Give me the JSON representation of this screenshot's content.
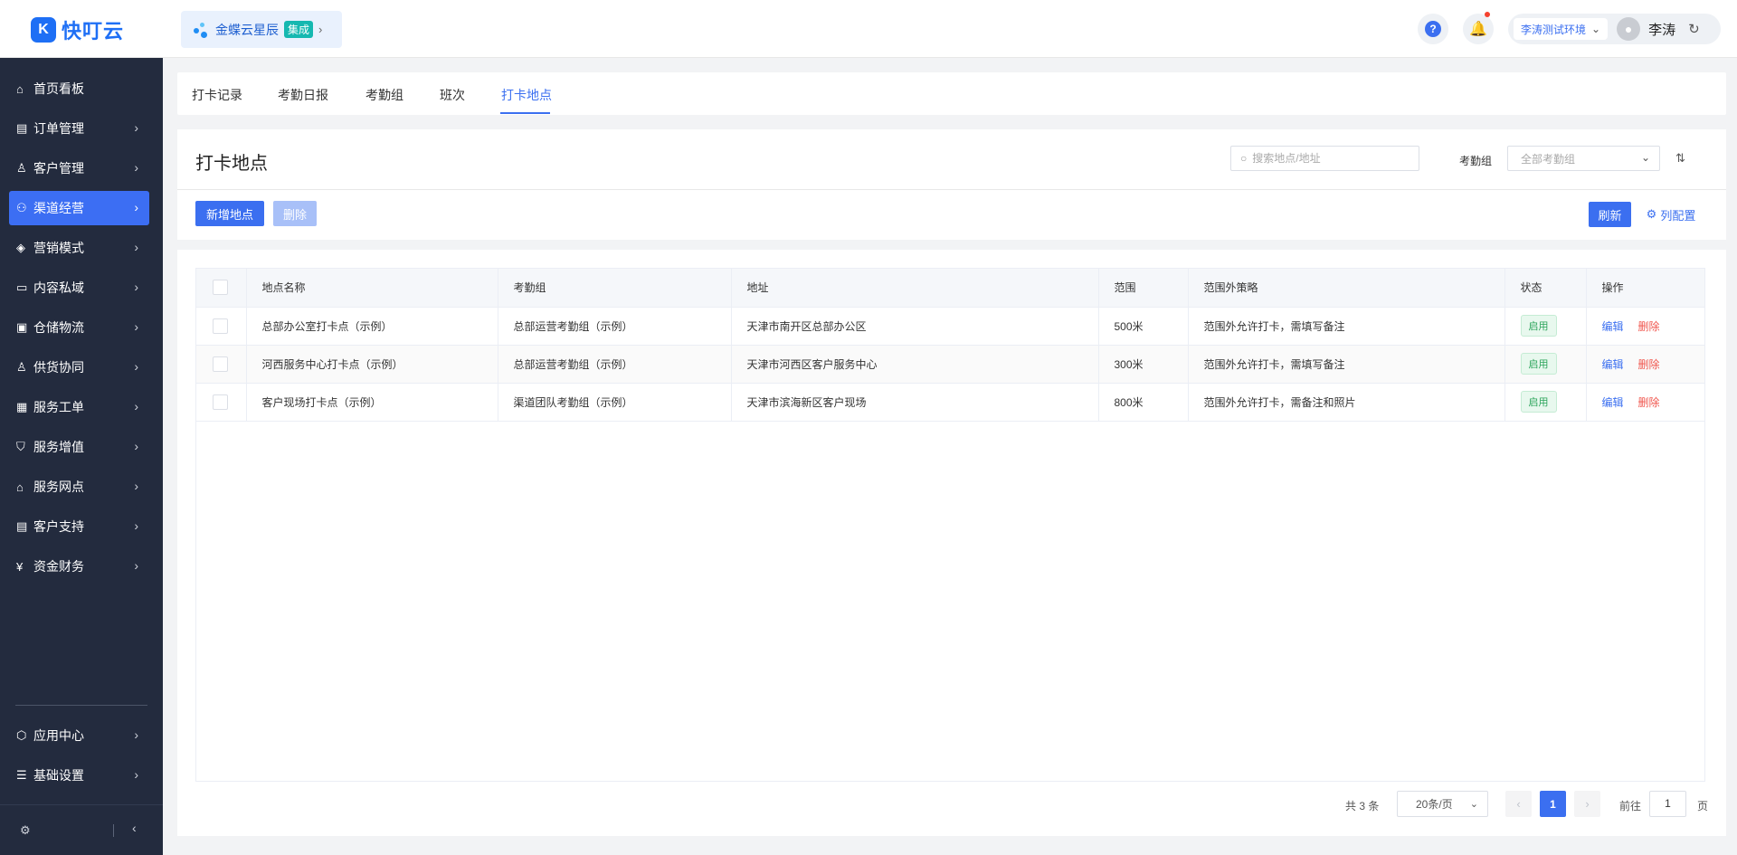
{
  "header": {
    "logo_text": "快叮云",
    "integration": {
      "name": "金蝶云星辰",
      "badge": "集成"
    },
    "env_label": "李涛测试环境",
    "user_name": "李涛"
  },
  "sidebar": {
    "items": [
      {
        "label": "首页看板",
        "icon": "home-icon",
        "has_arrow": false,
        "active": false
      },
      {
        "label": "订单管理",
        "icon": "order-icon",
        "has_arrow": true,
        "active": false
      },
      {
        "label": "客户管理",
        "icon": "customer-icon",
        "has_arrow": true,
        "active": false
      },
      {
        "label": "渠道经营",
        "icon": "channel-icon",
        "has_arrow": true,
        "active": true
      },
      {
        "label": "营销模式",
        "icon": "tag-icon",
        "has_arrow": true,
        "active": false
      },
      {
        "label": "内容私域",
        "icon": "image-icon",
        "has_arrow": true,
        "active": false
      },
      {
        "label": "仓储物流",
        "icon": "warehouse-icon",
        "has_arrow": true,
        "active": false
      },
      {
        "label": "供货协同",
        "icon": "supply-icon",
        "has_arrow": true,
        "active": false
      },
      {
        "label": "服务工单",
        "icon": "workorder-icon",
        "has_arrow": true,
        "active": false
      },
      {
        "label": "服务增值",
        "icon": "bag-icon",
        "has_arrow": true,
        "active": false
      },
      {
        "label": "服务网点",
        "icon": "store-icon",
        "has_arrow": true,
        "active": false
      },
      {
        "label": "客户支持",
        "icon": "support-icon",
        "has_arrow": true,
        "active": false
      },
      {
        "label": "资金财务",
        "icon": "yuan-icon",
        "has_arrow": true,
        "active": false
      }
    ],
    "bottom_items": [
      {
        "label": "应用中心",
        "icon": "cube-icon"
      },
      {
        "label": "基础设置",
        "icon": "settings-sliders-icon"
      }
    ]
  },
  "tabs": [
    {
      "label": "打卡记录",
      "active": false
    },
    {
      "label": "考勤日报",
      "active": false
    },
    {
      "label": "考勤组",
      "active": false
    },
    {
      "label": "班次",
      "active": false
    },
    {
      "label": "打卡地点",
      "active": true
    }
  ],
  "main": {
    "title": "打卡地点",
    "search": {
      "placeholder": "搜索地点/地址",
      "value": ""
    },
    "filter": {
      "label": "考勤组",
      "placeholder": "全部考勤组"
    },
    "buttons": {
      "add": "新增地点",
      "delete": "删除",
      "refresh": "刷新",
      "columns": "列配置"
    }
  },
  "table": {
    "columns": [
      "地点名称",
      "考勤组",
      "地址",
      "范围",
      "范围外策略",
      "状态",
      "操作"
    ],
    "rows": [
      {
        "name": "总部办公室打卡点（示例）",
        "group": "总部运营考勤组（示例）",
        "address": "天津市南开区总部办公区",
        "range": "500米",
        "policy": "范围外允许打卡，需填写备注",
        "status": "启用"
      },
      {
        "name": "河西服务中心打卡点（示例）",
        "group": "总部运营考勤组（示例）",
        "address": "天津市河西区客户服务中心",
        "range": "300米",
        "policy": "范围外允许打卡，需填写备注",
        "status": "启用"
      },
      {
        "name": "客户现场打卡点（示例）",
        "group": "渠道团队考勤组（示例）",
        "address": "天津市滨海新区客户现场",
        "range": "800米",
        "policy": "范围外允许打卡，需备注和照片",
        "status": "启用"
      }
    ],
    "actions": {
      "edit": "编辑",
      "delete": "删除"
    }
  },
  "pagination": {
    "total_text": "共 3 条",
    "page_size": "20条/页",
    "current_page": "1",
    "goto_label": "前往",
    "goto_value": "1",
    "page_suffix": "页"
  },
  "colors": {
    "primary": "#3b6ff0",
    "sidebar_bg": "#232b3e",
    "danger": "#f0564e",
    "success": "#2ba45a"
  }
}
